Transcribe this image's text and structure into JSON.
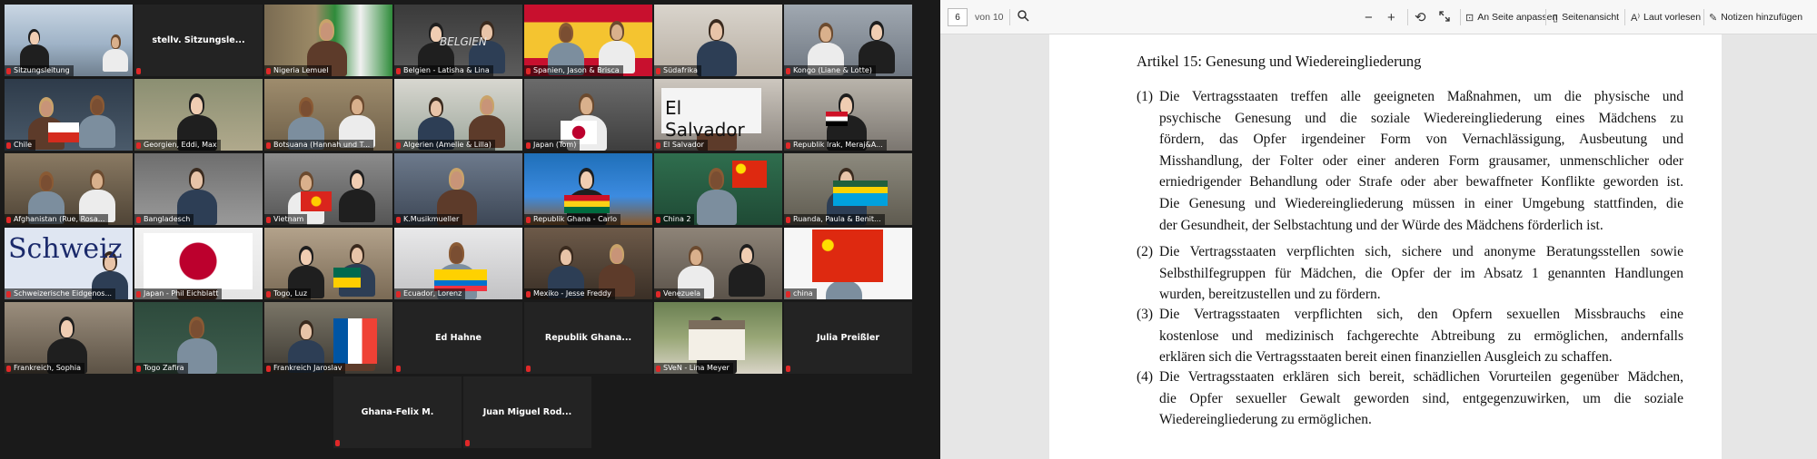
{
  "gallery": {
    "tiles": [
      {
        "name": "Sitzungsleitung",
        "video": true
      },
      {
        "name": "stellv. Sitzungsle...",
        "video": false
      },
      {
        "name": "Nigeria Lemuel",
        "video": true
      },
      {
        "name": "Belgien - Latisha & Lina",
        "video": true,
        "sign": "BELGIEN"
      },
      {
        "name": "Spanien, Jason & Brisca",
        "video": true
      },
      {
        "name": "Südafrika",
        "video": true
      },
      {
        "name": "Kongo (Liane & Lotte)",
        "video": true
      },
      {
        "name": "Chile",
        "video": true
      },
      {
        "name": "Georgien, Eddi, Max",
        "video": true
      },
      {
        "name": "Botsuana (Hannah und T...",
        "video": true
      },
      {
        "name": "Algerien (Amelie & Lilla)",
        "video": true
      },
      {
        "name": "Japan (Tom)",
        "video": true
      },
      {
        "name": "El Salvador",
        "video": true,
        "sign": "El Salvador"
      },
      {
        "name": "Republik Irak, Meraj&A...",
        "video": true
      },
      {
        "name": "Afghanistan (Rue, Rosa...",
        "video": true
      },
      {
        "name": "Bangladesch",
        "video": true
      },
      {
        "name": "Vietnam",
        "video": true
      },
      {
        "name": "K.Musikmueller",
        "video": true
      },
      {
        "name": "Republik Ghana - Carlo",
        "video": true
      },
      {
        "name": "China 2",
        "video": true
      },
      {
        "name": "Ruanda, Paula & Benit...",
        "video": true
      },
      {
        "name": "Schweizerische Eidgenos...",
        "video": true,
        "sign": "Schweiz"
      },
      {
        "name": "Japan - Phil Eichblatt",
        "video": true
      },
      {
        "name": "Togo, Luz",
        "video": true
      },
      {
        "name": "Ecuador, Lorenz",
        "video": true
      },
      {
        "name": "Mexiko - Jesse Freddy",
        "video": true
      },
      {
        "name": "Venezuela",
        "video": true
      },
      {
        "name": "china",
        "video": true
      },
      {
        "name": "Frankreich, Sophia",
        "video": true
      },
      {
        "name": "Togo Zafira",
        "video": true
      },
      {
        "name": "Frankreich Jaroslav",
        "video": true
      },
      {
        "name": "Ed Hahne",
        "video": false
      },
      {
        "name": "Republik  Ghana...",
        "video": false
      },
      {
        "name": "SVeN - Lina Meyer",
        "video": true
      },
      {
        "name": "Julia Preißler",
        "video": false
      },
      {
        "name": "Ghana-Felix M.",
        "video": false
      },
      {
        "name": "Juan Miguel Rod...",
        "video": false
      }
    ]
  },
  "viewer": {
    "page_current": "6",
    "page_total_label": "von 10",
    "toolbar": {
      "zoom_out": "−",
      "zoom_in": "+",
      "rotate": "⟲",
      "fit_label": "An Seite anpassen",
      "page_view_label": "Seitenansicht",
      "read_aloud_label": "Laut vorlesen",
      "add_notes_label": "Notizen hinzufügen"
    },
    "doc": {
      "heading": "Artikel 15: Genesung und Wiedereingliederung",
      "paragraphs": [
        {
          "num": "(1)",
          "lines": [
            "Die Vertragsstaaten treffen alle geeigneten Maßnahmen, um die physische und",
            "psychische Genesung und die soziale Wiedereingliederung eines Mädchens zu",
            "fördern, das Opfer irgendeiner Form von Vernachlässigung, Ausbeutung und",
            "Misshandlung, der Folter oder einer anderen Form grausamer, unmenschlicher oder",
            "erniedrigender Behandlung oder Strafe oder aber bewaffneter Konflikte geworden ist.",
            "Die Genesung und Wiedereingliederung müssen in einer Umgebung stattfinden, die",
            "der Gesundheit, der Selbstachtung und der Würde des Mädchens förderlich ist."
          ]
        },
        {
          "num": "(2)",
          "lines": [
            "Die Vertragsstaaten verpflichten sich, sichere und anonyme Beratungsstellen sowie",
            "Selbsthilfegruppen für Mädchen, die Opfer der im Absatz 1 genannten Handlungen",
            "wurden, bereitzustellen und zu fördern."
          ]
        },
        {
          "num": "(3)",
          "lines": [
            "Die Vertragsstaaten verpflichten sich, den Opfern sexuellen Missbrauchs eine",
            "kostenlose und medizinisch fachgerechte Abtreibung zu ermöglichen, andernfalls",
            "erklären sich die Vertragsstaaten bereit einen finanziellen Ausgleich zu schaffen."
          ]
        },
        {
          "num": "(4)",
          "lines": [
            "Die Vertragsstaaten erklären sich bereit, schädlichen Vorurteilen gegenüber Mädchen,",
            "die Opfer sexueller Gewalt geworden sind, entgegenzuwirken, um die soziale",
            "Wiedereingliederung zu ermöglichen."
          ]
        }
      ]
    }
  }
}
